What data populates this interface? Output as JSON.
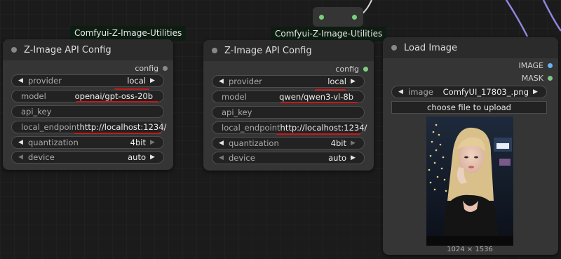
{
  "groups": [
    {
      "label": "Comfyui-Z-Image-Utilities"
    },
    {
      "label": "Comfyui-Z-Image-Utilities"
    }
  ],
  "nodes": [
    {
      "title": "Z-Image API Config",
      "output": "config",
      "widgets": [
        {
          "label": "provider",
          "value": "local"
        },
        {
          "label": "model",
          "value": "openai/gpt-oss-20b"
        },
        {
          "label": "api_key",
          "value": ""
        },
        {
          "label": "local_endpoint",
          "value": "http://localhost:1234/"
        },
        {
          "label": "quantization",
          "value": "4bit"
        },
        {
          "label": "device",
          "value": "auto"
        }
      ]
    },
    {
      "title": "Z-Image API Config",
      "output": "config",
      "widgets": [
        {
          "label": "provider",
          "value": "local"
        },
        {
          "label": "model",
          "value": "qwen/qwen3-vl-8b"
        },
        {
          "label": "api_key",
          "value": ""
        },
        {
          "label": "local_endpoint",
          "value": "http://localhost:1234/"
        },
        {
          "label": "quantization",
          "value": "4bit"
        },
        {
          "label": "device",
          "value": "auto"
        }
      ]
    }
  ],
  "load_image": {
    "title": "Load Image",
    "outputs": [
      {
        "label": "IMAGE",
        "color": "#64b5f6"
      },
      {
        "label": "MASK",
        "color": "#81c784"
      }
    ],
    "image_widget": {
      "label": "image",
      "value": "ComfyUI_17803_.png"
    },
    "upload_label": "choose file to upload",
    "dimensions": "1024 × 1536"
  },
  "colors": {
    "annotation_underline": "#c41a1a",
    "config_slot_connected": "#7ccf7c",
    "config_slot_idle": "#8a8a8a"
  }
}
